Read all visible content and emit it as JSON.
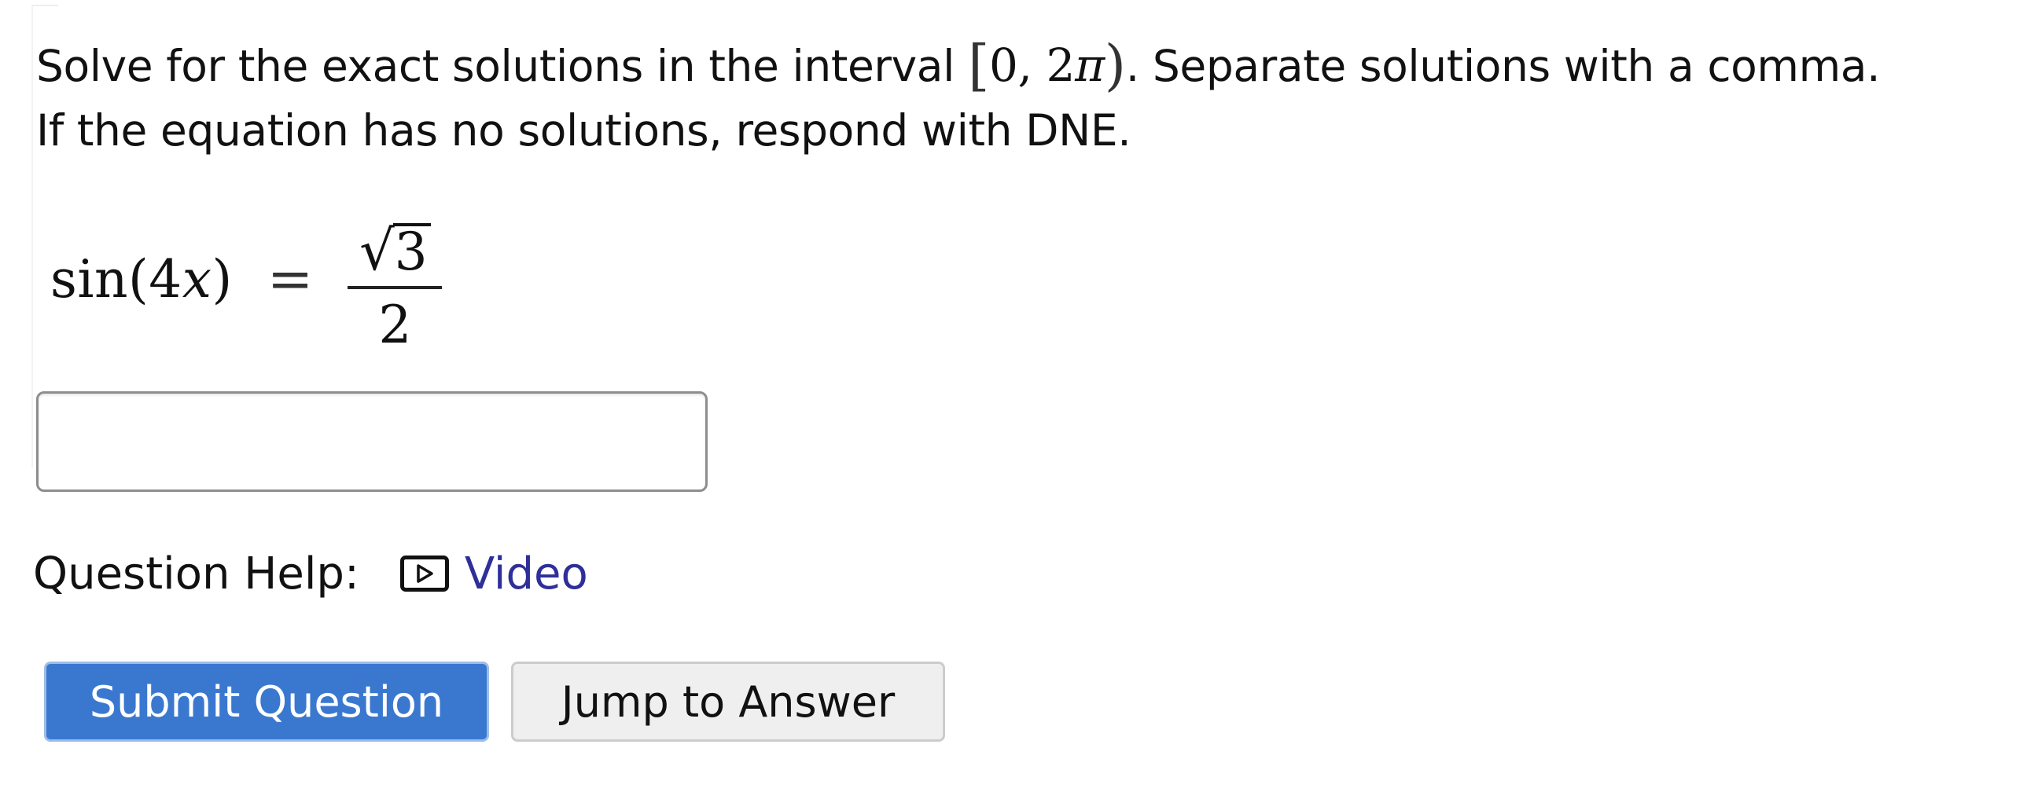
{
  "question": {
    "prompt_before_interval": "Solve for the exact solutions in the interval ",
    "interval_open": "[",
    "interval_body": "0, 2",
    "interval_pi": "π",
    "interval_close": ")",
    "prompt_after_interval": ". Separate solutions with a comma.",
    "prompt_line2": "If the equation has no solutions, respond with DNE."
  },
  "equation": {
    "lhs": "sin(4",
    "lhs_var": "x",
    "lhs_close": ")",
    "equals": "=",
    "numerator_radical": "√",
    "numerator_radicand": "3",
    "denominator": "2"
  },
  "answer": {
    "value": "",
    "placeholder": ""
  },
  "help": {
    "label": "Question Help:",
    "icon": "video-play-icon",
    "video_link": "Video"
  },
  "buttons": {
    "submit": "Submit Question",
    "jump": "Jump to Answer"
  },
  "colors": {
    "submit_bg": "#3a78d0",
    "link": "#2f2f9a",
    "jump_bg": "#efefef"
  }
}
